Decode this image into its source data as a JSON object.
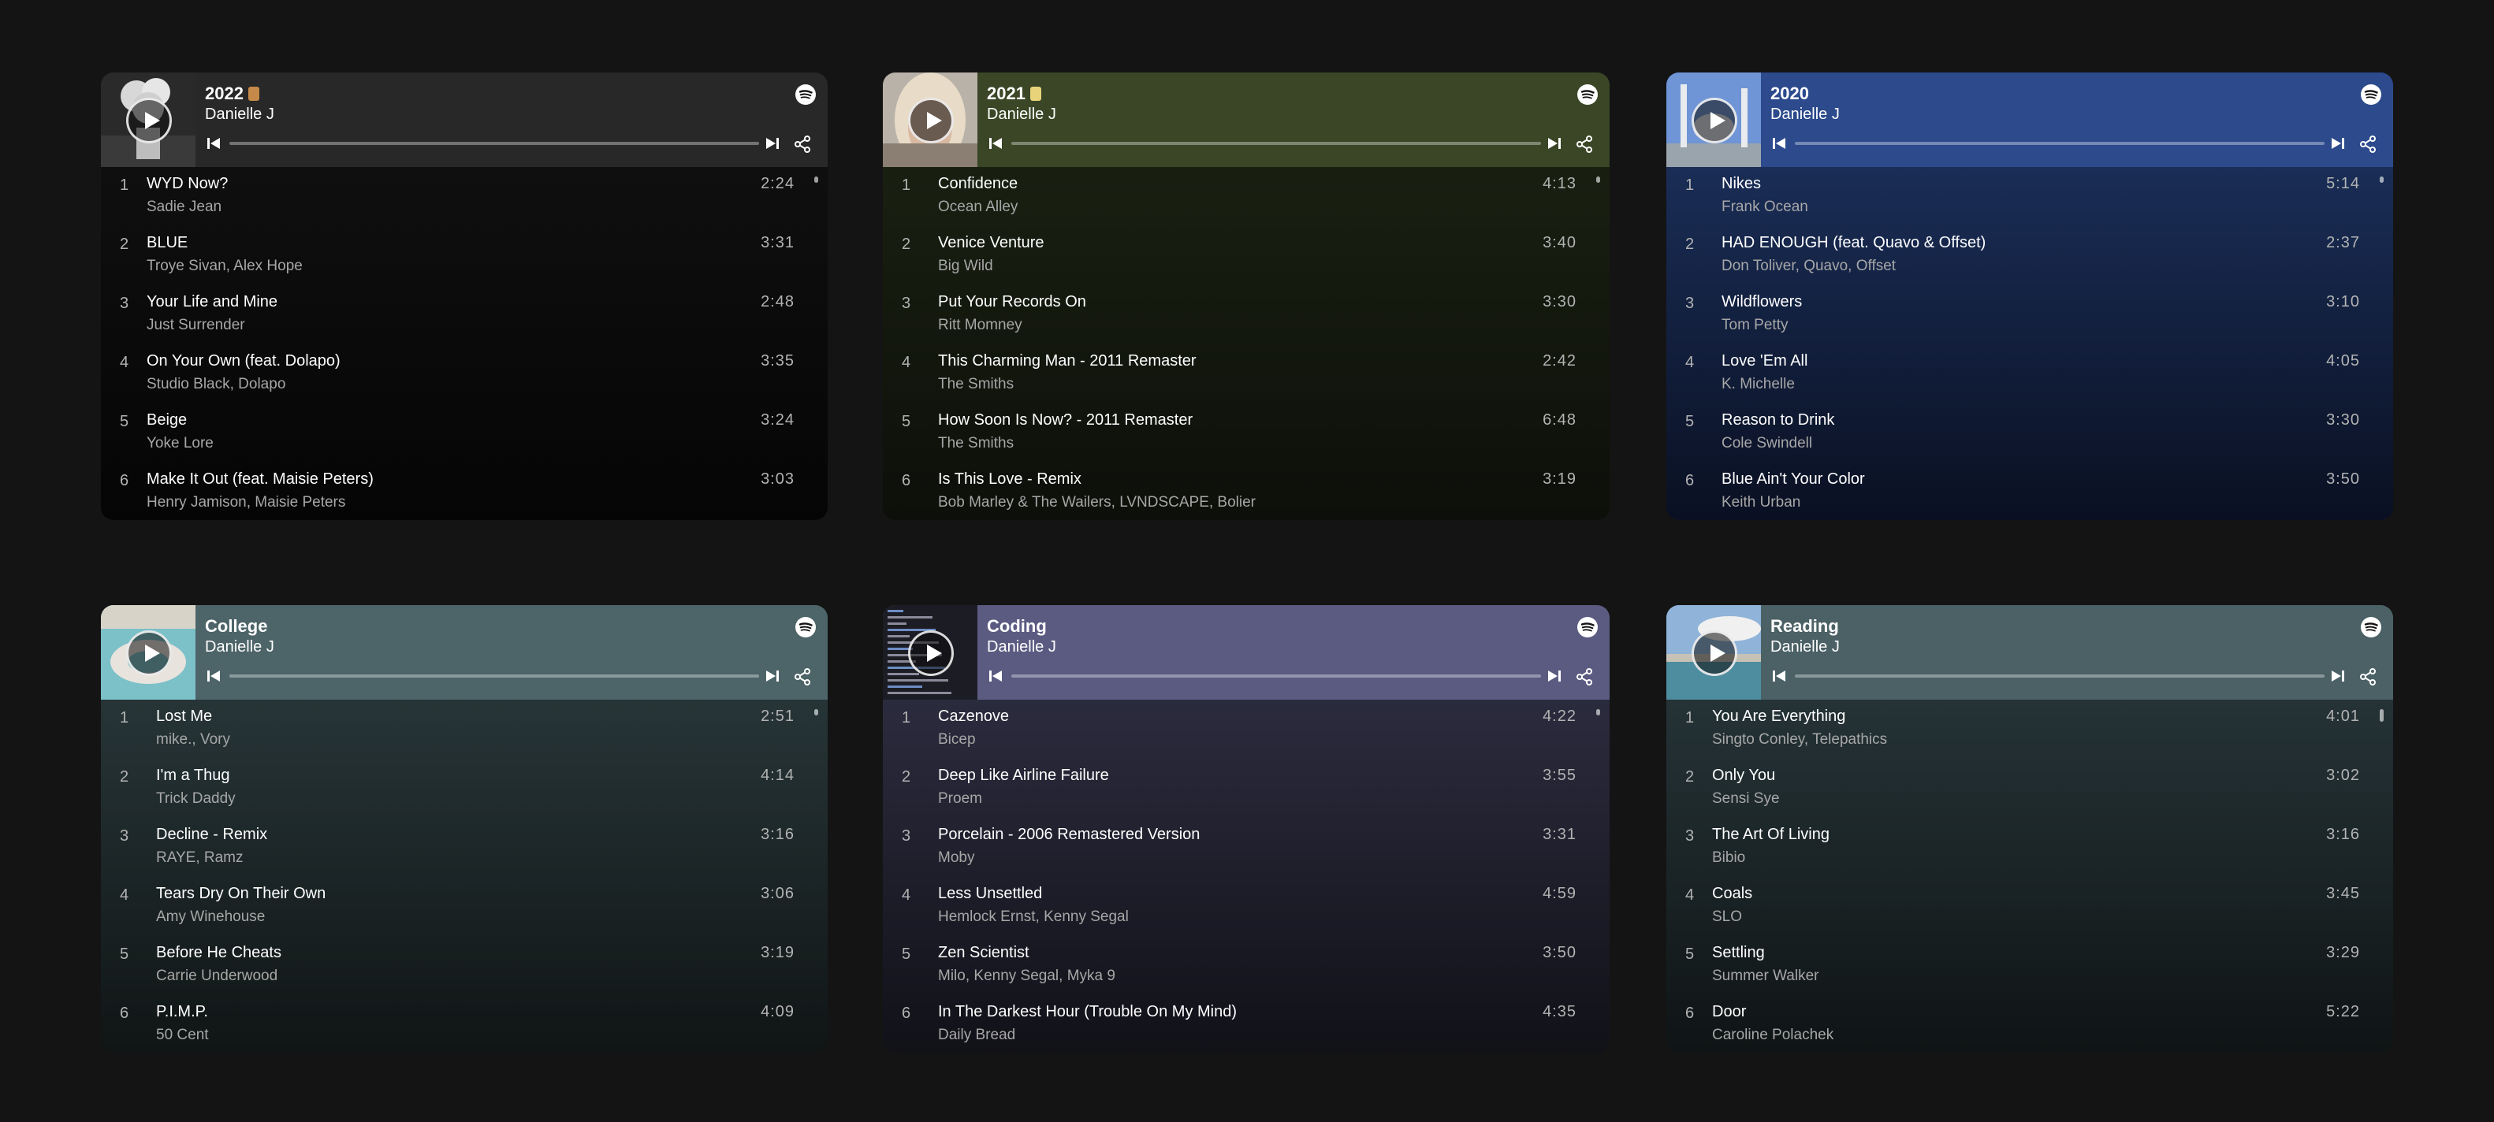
{
  "playlists": [
    {
      "title": "2022",
      "title_emoji": "coffee-emoji",
      "owner": "Danielle J",
      "header_color": "#282828",
      "body_top": "#121212",
      "body_bottom": "#050505",
      "cover": "white-flowers-vase",
      "tracks": [
        {
          "num": "1",
          "name": "WYD Now?",
          "artist": "Sadie Jean",
          "duration": "2:24"
        },
        {
          "num": "2",
          "name": "BLUE",
          "artist": "Troye Sivan, Alex Hope",
          "duration": "3:31"
        },
        {
          "num": "3",
          "name": "Your Life and Mine",
          "artist": "Just Surrender",
          "duration": "2:48"
        },
        {
          "num": "4",
          "name": "On Your Own (feat. Dolapo)",
          "artist": "Studio Black, Dolapo",
          "duration": "3:35"
        },
        {
          "num": "5",
          "name": "Beige",
          "artist": "Yoke Lore",
          "duration": "3:24"
        },
        {
          "num": "6",
          "name": "Make It Out (feat. Maisie Peters)",
          "artist": "Henry Jamison, Maisie Peters",
          "duration": "3:03"
        }
      ]
    },
    {
      "title": "2021",
      "title_emoji": "lemon-emoji",
      "owner": "Danielle J",
      "header_color": "#3a4626",
      "body_top": "#1c2413",
      "body_bottom": "#0d0f0a",
      "cover": "blonde-selfie",
      "tracks": [
        {
          "num": "1",
          "name": "Confidence",
          "artist": "Ocean Alley",
          "duration": "4:13"
        },
        {
          "num": "2",
          "name": "Venice Venture",
          "artist": "Big Wild",
          "duration": "3:40"
        },
        {
          "num": "3",
          "name": "Put Your Records On",
          "artist": "Ritt Momney",
          "duration": "3:30"
        },
        {
          "num": "4",
          "name": "This Charming Man - 2011 Remaster",
          "artist": "The Smiths",
          "duration": "2:42"
        },
        {
          "num": "5",
          "name": "How Soon Is Now? - 2011 Remaster",
          "artist": "The Smiths",
          "duration": "6:48"
        },
        {
          "num": "6",
          "name": "Is This Love - Remix",
          "artist": "Bob Marley & The Wailers, LVNDSCAPE, Bolier",
          "duration": "3:19"
        }
      ]
    },
    {
      "title": "2020",
      "title_emoji": "",
      "owner": "Danielle J",
      "header_color": "#2c4a8c",
      "body_top": "#1e3564",
      "body_bottom": "#0a1022",
      "cover": "mosque-towers",
      "tracks": [
        {
          "num": "1",
          "name": "Nikes",
          "artist": "Frank Ocean",
          "duration": "5:14"
        },
        {
          "num": "2",
          "name": "HAD ENOUGH (feat. Quavo & Offset)",
          "artist": "Don Toliver, Quavo, Offset",
          "duration": "2:37"
        },
        {
          "num": "3",
          "name": "Wildflowers",
          "artist": "Tom Petty",
          "duration": "3:10"
        },
        {
          "num": "4",
          "name": "Love 'Em All",
          "artist": "K. Michelle",
          "duration": "4:05"
        },
        {
          "num": "5",
          "name": "Reason to Drink",
          "artist": "Cole Swindell",
          "duration": "3:30"
        },
        {
          "num": "6",
          "name": "Blue Ain't Your Color",
          "artist": "Keith Urban",
          "duration": "3:50"
        }
      ]
    },
    {
      "title": "College",
      "title_emoji": "",
      "owner": "Danielle J",
      "header_color": "#4d6468",
      "body_top": "#2d3d40",
      "body_bottom": "#101515",
      "cover": "pool-float",
      "tracks": [
        {
          "num": "1",
          "name": "Lost Me",
          "artist": "mike., Vory",
          "duration": "2:51"
        },
        {
          "num": "2",
          "name": "I'm a Thug",
          "artist": "Trick Daddy",
          "duration": "4:14"
        },
        {
          "num": "3",
          "name": "Decline - Remix",
          "artist": "RAYE, Ramz",
          "duration": "3:16"
        },
        {
          "num": "4",
          "name": "Tears Dry On Their Own",
          "artist": "Amy Winehouse",
          "duration": "3:06"
        },
        {
          "num": "5",
          "name": "Before He Cheats",
          "artist": "Carrie Underwood",
          "duration": "3:19"
        },
        {
          "num": "6",
          "name": "P.I.M.P.",
          "artist": "50 Cent",
          "duration": "4:09"
        }
      ]
    },
    {
      "title": "Coding",
      "title_emoji": "",
      "owner": "Danielle J",
      "header_color": "#5b5b82",
      "body_top": "#323248",
      "body_bottom": "#111118",
      "cover": "code-screen",
      "tracks": [
        {
          "num": "1",
          "name": "Cazenove",
          "artist": "Bicep",
          "duration": "4:22"
        },
        {
          "num": "2",
          "name": "Deep Like Airline Failure",
          "artist": "Proem",
          "duration": "3:55"
        },
        {
          "num": "3",
          "name": "Porcelain - 2006 Remastered Version",
          "artist": "Moby",
          "duration": "3:31"
        },
        {
          "num": "4",
          "name": "Less Unsettled",
          "artist": "Hemlock Ernst, Kenny Segal",
          "duration": "4:59"
        },
        {
          "num": "5",
          "name": "Zen Scientist",
          "artist": "Milo, Kenny Segal, Myka 9",
          "duration": "3:50"
        },
        {
          "num": "6",
          "name": "In The Darkest Hour (Trouble On My Mind)",
          "artist": "Daily Bread",
          "duration": "4:35"
        }
      ]
    },
    {
      "title": "Reading",
      "title_emoji": "",
      "owner": "Danielle J",
      "header_color": "#4b6166",
      "body_top": "#2b3b3f",
      "body_bottom": "#0f1415",
      "cover": "poolside-sky",
      "tracks": [
        {
          "num": "1",
          "name": "You Are Everything",
          "artist": "Singto Conley, Telepathics",
          "duration": "4:01"
        },
        {
          "num": "2",
          "name": "Only You",
          "artist": "Sensi Sye",
          "duration": "3:02"
        },
        {
          "num": "3",
          "name": "The Art Of Living",
          "artist": "Bibio",
          "duration": "3:16"
        },
        {
          "num": "4",
          "name": "Coals",
          "artist": "SLO",
          "duration": "3:45"
        },
        {
          "num": "5",
          "name": "Settling",
          "artist": "Summer Walker",
          "duration": "3:29"
        },
        {
          "num": "6",
          "name": "Door",
          "artist": "Caroline Polachek",
          "duration": "5:22"
        }
      ]
    }
  ]
}
